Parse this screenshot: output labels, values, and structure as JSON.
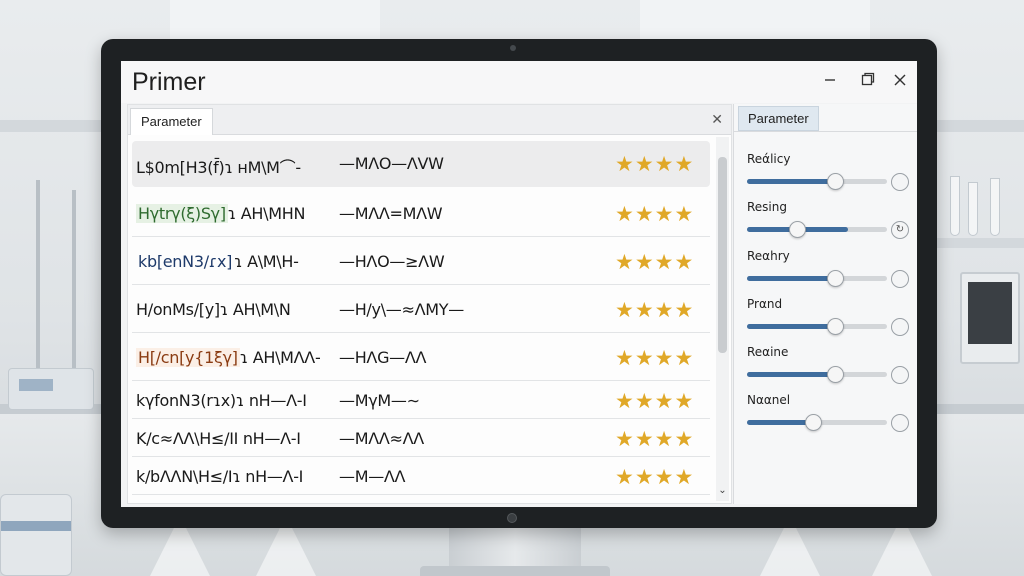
{
  "window": {
    "title": "Primer"
  },
  "left_panel": {
    "tab_label": "Parameter",
    "rows": [
      {
        "pre": "L$0m[H3(f̄)",
        "hl": "",
        "post": "ɿ ʜM\\M⌒-",
        "seq": "—MΛO—ΛVW",
        "rating": 4
      },
      {
        "pre": "",
        "hl": "Hγtrγ(ξ)Sγ]",
        "post": "ɿ AH\\MHN",
        "seq": "—MΛΛ=MΛW",
        "rating": 4
      },
      {
        "pre": "",
        "hl": "kb[enN3/ɾx]",
        "post": "ɿ A\\M\\H-",
        "seq": "—HΛO—≥ΛW",
        "rating": 4
      },
      {
        "pre": "H/onMs/[y]",
        "hl": "",
        "post": "ɿ AH\\M\\N",
        "seq": "—H/y\\—≈ΛMY—",
        "rating": 4
      },
      {
        "pre": "",
        "hl": "H[/cn[y{1ξγ]",
        "post": "ɿ AH\\MΛΛ-",
        "seq": "—HΛG—ΛΛ",
        "rating": 4
      },
      {
        "pre": "kγfonN3(rɿx)",
        "hl": "",
        "post": "ɿ nH—Λ-I",
        "seq": "—MγM—∼",
        "rating": 4
      },
      {
        "pre": "K/c≈ΛΛ\\H≤/I",
        "hl": "",
        "post": "I nH—Λ-I",
        "seq": "—MΛΛ≈ΛΛ",
        "rating": 4
      },
      {
        "pre": "k/bΛΛN\\H≤/I",
        "hl": "",
        "post": "ɿ nH—Λ-I",
        "seq": "—M—ΛΛ",
        "rating": 4
      }
    ]
  },
  "right_panel": {
    "tab_label": "Parameter",
    "params": [
      {
        "label": "Reάlicy",
        "value": 0.63,
        "fill": 0.63,
        "icon": "circle-icon",
        "glyph": ""
      },
      {
        "label": "Resing",
        "value": 0.36,
        "fill": 0.72,
        "icon": "refresh-icon",
        "glyph": "↻"
      },
      {
        "label": "Reαhry",
        "value": 0.63,
        "fill": 0.63,
        "icon": "circle-icon",
        "glyph": ""
      },
      {
        "label": "Prαnd",
        "value": 0.63,
        "fill": 0.63,
        "icon": "circle-icon",
        "glyph": ""
      },
      {
        "label": "Reαine",
        "value": 0.63,
        "fill": 0.63,
        "icon": "circle-icon",
        "glyph": ""
      },
      {
        "label": "Nααnel",
        "value": 0.47,
        "fill": 0.47,
        "icon": "circle-icon",
        "glyph": ""
      }
    ]
  },
  "colors": {
    "accent": "#3f6d9e",
    "star": "#e0a828",
    "highlight_green": "#2f6b2f",
    "highlight_blue": "#1e3a6a",
    "highlight_brown": "#8a3b12"
  }
}
